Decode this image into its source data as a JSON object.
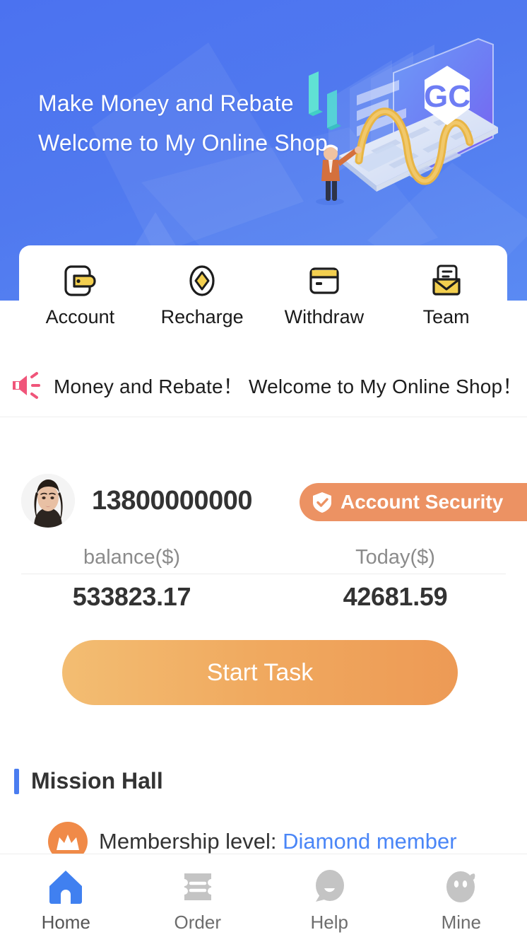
{
  "banner": {
    "line1": "Make Money and Rebate",
    "line2": "Welcome to My Online Shop",
    "logo_text": "GC",
    "bg_color": "#4b72f0"
  },
  "quick_actions": [
    {
      "label": "Account",
      "icon": "wallet-icon"
    },
    {
      "label": "Recharge",
      "icon": "diamond-circle-icon"
    },
    {
      "label": "Withdraw",
      "icon": "credit-card-icon"
    },
    {
      "label": "Team",
      "icon": "envelope-icon"
    }
  ],
  "notice": {
    "icon": "megaphone-icon",
    "icon_color": "#f0557a",
    "text": "Money and Rebate！ Welcome to My Online Shop！"
  },
  "profile": {
    "avatar": "user-avatar",
    "phone": "13800000000",
    "security_badge": {
      "label": "Account Security",
      "icon": "shield-check-icon",
      "color": "#ec9263"
    }
  },
  "balance": {
    "columns": [
      {
        "label": "balance($)",
        "value": "533823.17"
      },
      {
        "label": "Today($)",
        "value": "42681.59"
      }
    ]
  },
  "start_task": {
    "label": "Start Task",
    "gradient_from": "#f3bd72",
    "gradient_to": "#ed9a55"
  },
  "mission_hall": {
    "title": "Mission Hall",
    "accent_color": "#4a7df0",
    "rows": [
      {
        "prefix": "Membership level: ",
        "level": "Diamond member",
        "level_color": "#4a86f7",
        "icon": "crown-avatar-icon"
      }
    ]
  },
  "tabbar": {
    "items": [
      {
        "label": "Home",
        "icon": "home-icon",
        "active": true,
        "color": "#4080f0"
      },
      {
        "label": "Order",
        "icon": "ticket-icon",
        "active": false,
        "color": "#c4c4c4"
      },
      {
        "label": "Help",
        "icon": "chat-smile-icon",
        "active": false,
        "color": "#c4c4c4"
      },
      {
        "label": "Mine",
        "icon": "face-icon",
        "active": false,
        "color": "#c4c4c4"
      }
    ]
  }
}
